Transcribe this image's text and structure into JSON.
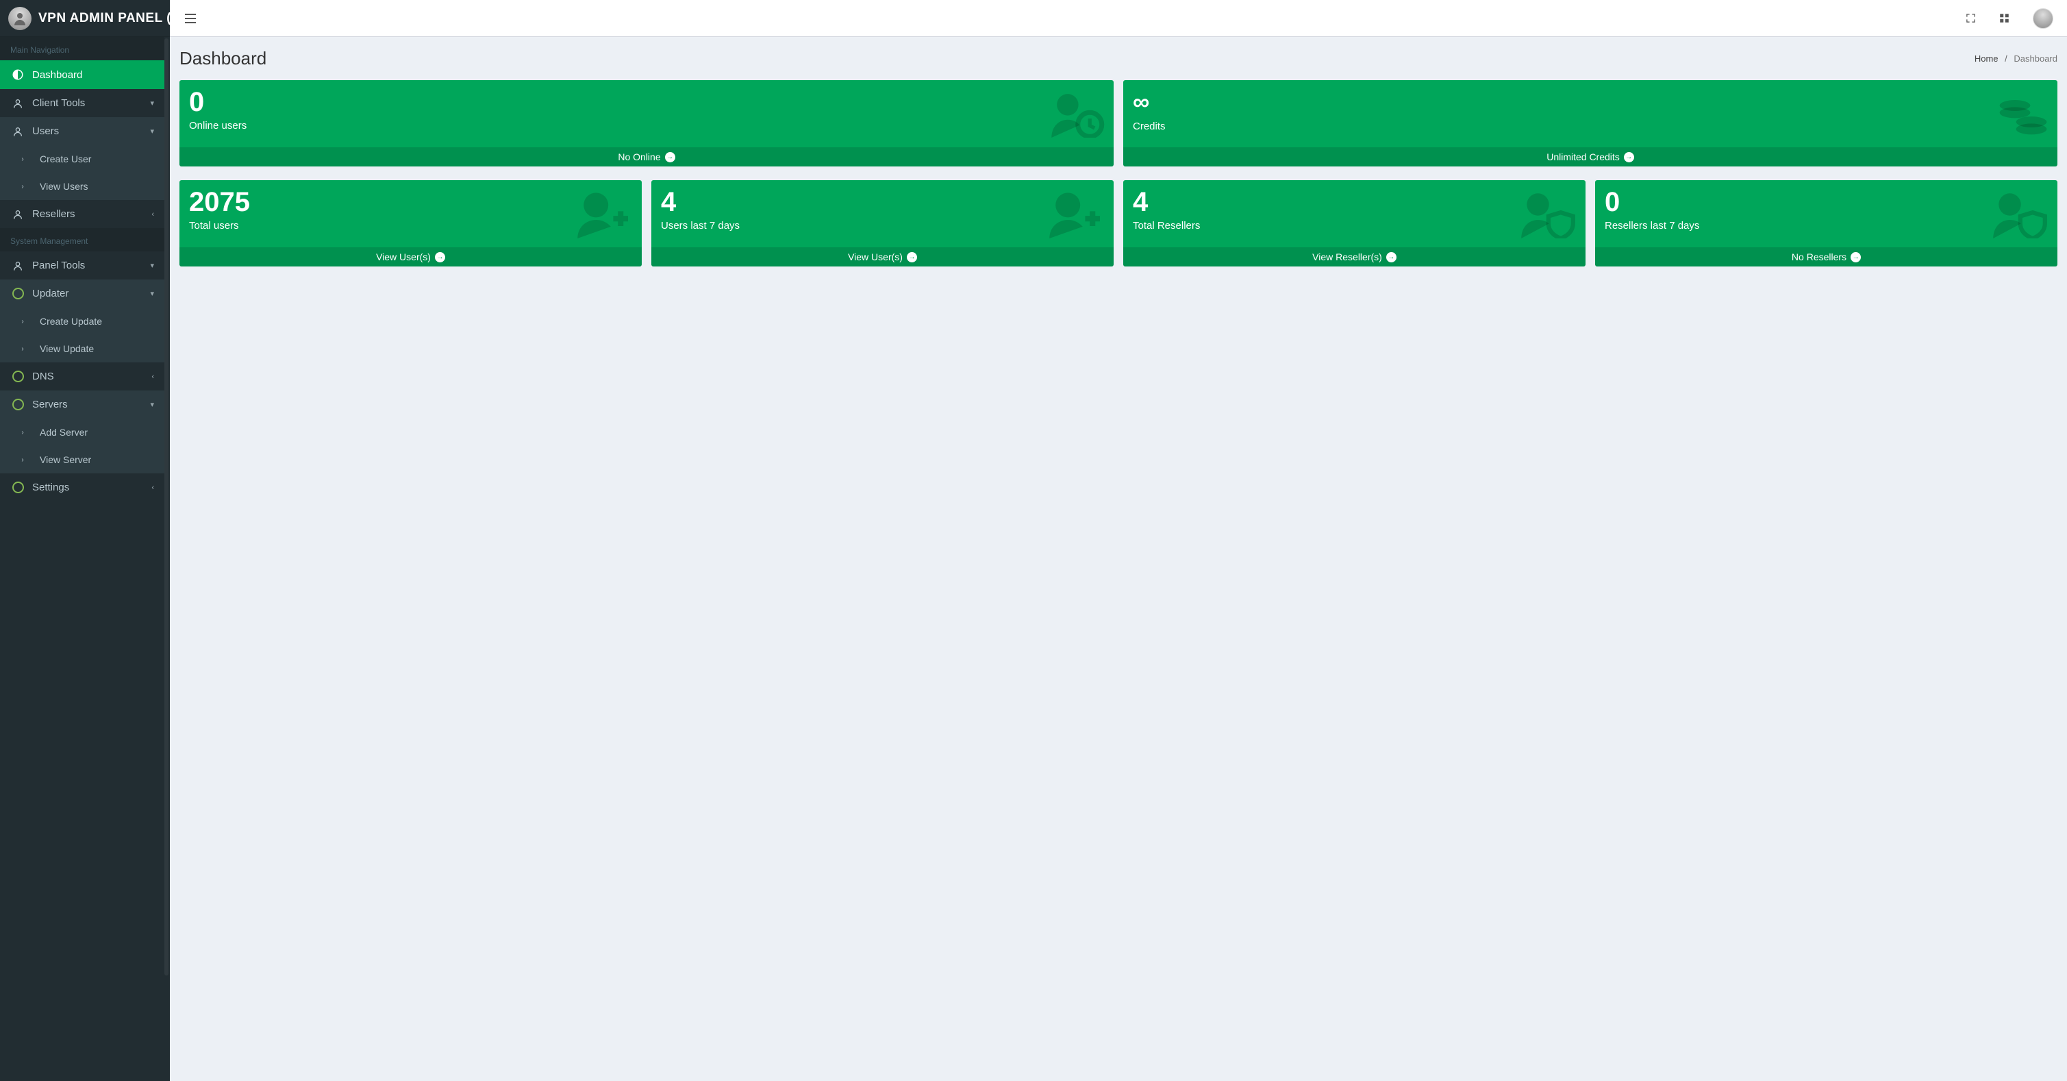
{
  "brand": {
    "title": "VPN ADMIN PANEL (Us"
  },
  "sidebar": {
    "headers": {
      "main": "Main Navigation",
      "system": "System Management"
    },
    "dashboard": "Dashboard",
    "client_tools": "Client Tools",
    "users": "Users",
    "create_user": "Create User",
    "view_users": "View Users",
    "resellers": "Resellers",
    "panel_tools": "Panel Tools",
    "updater": "Updater",
    "create_update": "Create Update",
    "view_update": "View Update",
    "dns": "DNS",
    "servers": "Servers",
    "add_server": "Add Server",
    "view_server": "View Server",
    "settings": "Settings"
  },
  "header": {
    "title": "Dashboard",
    "breadcrumb_home": "Home",
    "breadcrumb_sep": "/",
    "breadcrumb_current": "Dashboard"
  },
  "cards": {
    "online_users": {
      "value": "0",
      "label": "Online users",
      "foot": "No Online"
    },
    "credits": {
      "value": "∞",
      "label": "Credits",
      "foot": "Unlimited Credits"
    },
    "total_users": {
      "value": "2075",
      "label": "Total users",
      "foot": "View User(s)"
    },
    "users_7d": {
      "value": "4",
      "label": "Users last 7 days",
      "foot": "View User(s)"
    },
    "total_resellers": {
      "value": "4",
      "label": "Total Resellers",
      "foot": "View Reseller(s)"
    },
    "resellers_7d": {
      "value": "0",
      "label": "Resellers last 7 days",
      "foot": "No Resellers"
    }
  }
}
